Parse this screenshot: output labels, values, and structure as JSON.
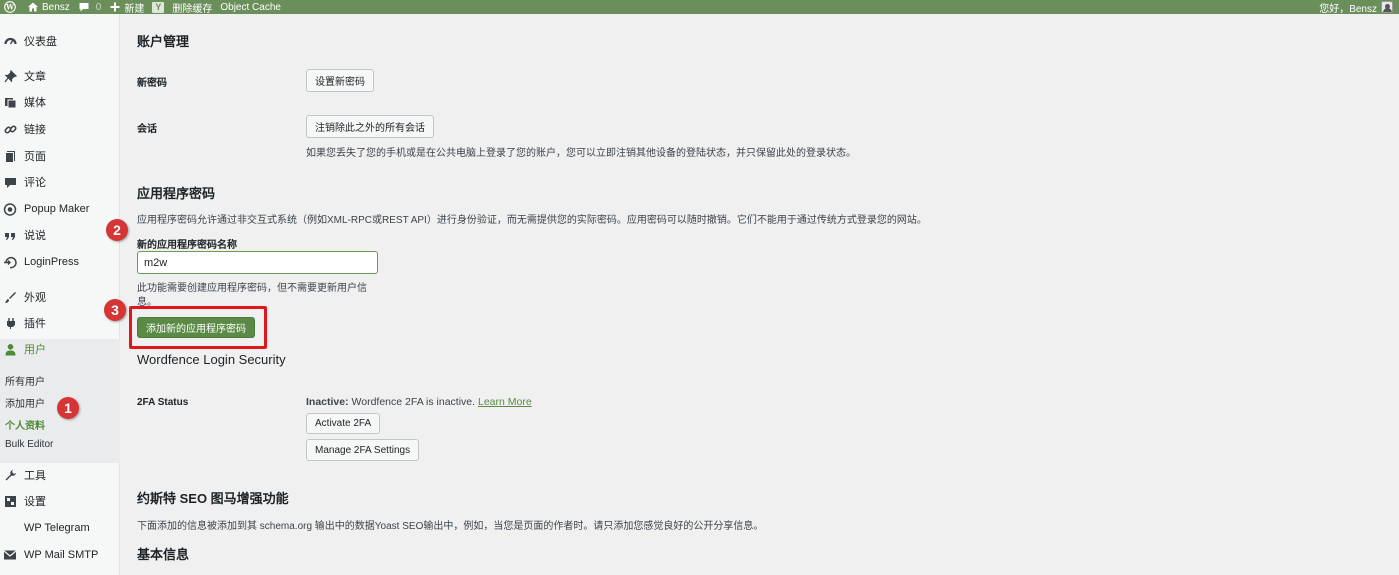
{
  "adminbar": {
    "site_name": "Bensz",
    "comments_count": "0",
    "new_label": "新建",
    "yoast_label": "Y",
    "purge_cache_label": "删除缓存",
    "object_cache_label": "Object Cache",
    "greeting": "您好，Bensz"
  },
  "sidebar": {
    "items": [
      {
        "label": "仪表盘",
        "icon": "dashboard-icon"
      },
      {
        "label": "文章",
        "icon": "pin-icon"
      },
      {
        "label": "媒体",
        "icon": "media-icon"
      },
      {
        "label": "链接",
        "icon": "link-icon"
      },
      {
        "label": "页面",
        "icon": "page-icon"
      },
      {
        "label": "评论",
        "icon": "comment-icon"
      },
      {
        "label": "Popup Maker",
        "icon": "popup-icon"
      },
      {
        "label": "说说",
        "icon": "quote-icon"
      },
      {
        "label": "LoginPress",
        "icon": "loginpress-icon"
      },
      {
        "label": "外观",
        "icon": "brush-icon"
      },
      {
        "label": "插件",
        "icon": "plugin-icon"
      },
      {
        "label": "用户",
        "icon": "user-icon"
      },
      {
        "label": "工具",
        "icon": "wrench-icon"
      },
      {
        "label": "设置",
        "icon": "settings-icon"
      },
      {
        "label": "WP Telegram",
        "icon": "telegram-icon"
      },
      {
        "label": "WP Mail SMTP",
        "icon": "mail-icon"
      }
    ],
    "users_submenu": [
      "所有用户",
      "添加用户",
      "个人资料",
      "Bulk Editor"
    ]
  },
  "account": {
    "title": "账户管理",
    "new_password_label": "新密码",
    "set_password_button": "设置新密码",
    "sessions_label": "会话",
    "logout_others_button": "注销除此之外的所有会话",
    "sessions_desc": "如果您丢失了您的手机或是在公共电脑上登录了您的账户，您可以立即注销其他设备的登陆状态，并只保留此处的登录状态。"
  },
  "app_passwords": {
    "title": "应用程序密码",
    "desc": "应用程序密码允许通过非交互式系统（例如XML-RPC或REST API）进行身份验证，而无需提供您的实际密码。应用密码可以随时撤销。它们不能用于通过传统方式登录您的网站。",
    "name_label": "新的应用程序密码名称",
    "name_value": "m2w",
    "help_line1": "此功能需要创建应用程序密码，但不需要更新用户信",
    "help_line2": "息。",
    "add_button": "添加新的应用程序密码"
  },
  "wordfence": {
    "title": "Wordfence Login Security",
    "status_label": "2FA Status",
    "inactive_prefix": "Inactive:",
    "inactive_text": " Wordfence 2FA is inactive. ",
    "learn_more": "Learn More",
    "activate_button": "Activate 2FA",
    "manage_button": "Manage 2FA Settings"
  },
  "yoast": {
    "title": "约斯特 SEO 图马增强功能",
    "desc": "下面添加的信息被添加到其 schema.org 输出中的数据Yoast SEO输出中，例如，当您是页面的作者时。请只添加您感觉良好的公开分享信息。"
  },
  "basic_info": {
    "title": "基本信息"
  },
  "annotations": [
    "1",
    "2",
    "3"
  ],
  "colors": {
    "adminbar": "#6a8f5a",
    "accent": "#4e8a37",
    "primary_button": "#5a8a46",
    "highlight": "#e0161b",
    "badge": "#d53535"
  }
}
